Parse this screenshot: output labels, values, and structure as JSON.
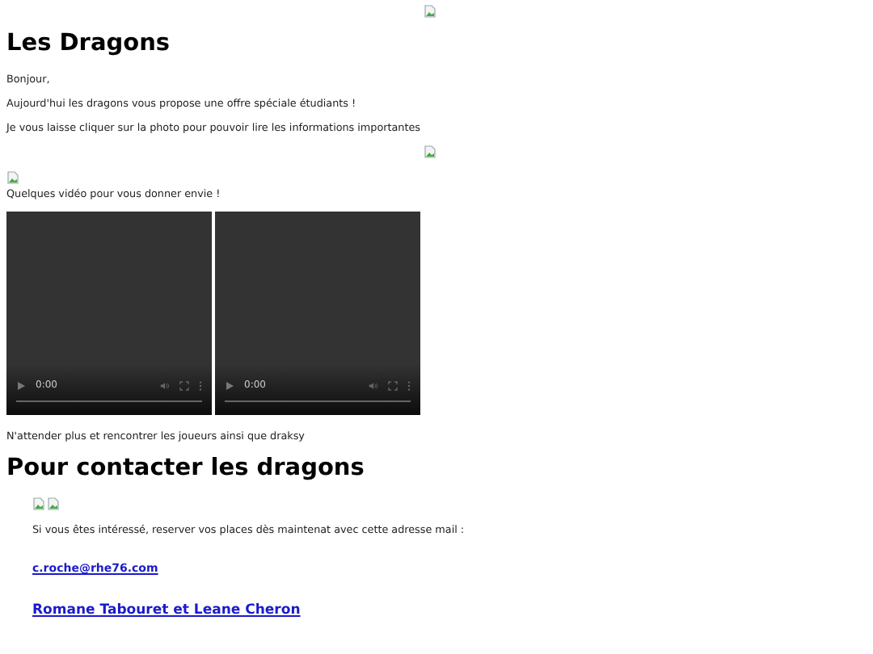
{
  "title": "Les Dragons",
  "intro": [
    "Bonjour,",
    "Aujourd'hui les dragons vous propose une offre spéciale étudiants !",
    "Je vous laisse cliquer sur la photo pour pouvoir lire les informations importantes"
  ],
  "videos_caption": "Quelques vidéo pour vous donner envie !",
  "videos": [
    {
      "time": "0:00"
    },
    {
      "time": "0:00"
    }
  ],
  "outro": "N'attender plus et rencontrer les joueurs ainsi que draksy",
  "contact": {
    "heading": "Pour contacter les dragons",
    "text": "Si vous êtes intéressé, reserver vos places dès maintenat avec cette adresse mail :",
    "email": "c.roche@rhe76.com",
    "authors": "Romane Tabouret et Leane Cheron"
  }
}
